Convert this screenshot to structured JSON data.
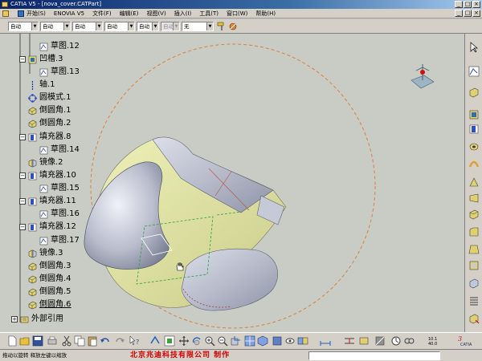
{
  "window": {
    "title": "CATIA V5 - [nova_cover.CATPart]",
    "controls": [
      "_",
      "□",
      "×"
    ]
  },
  "menubar": {
    "items": [
      "开始(S)",
      "ENOVIA V5",
      "文件(F)",
      "编辑(E)",
      "视图(V)",
      "插入(I)",
      "工具(T)",
      "窗口(W)",
      "帮助(H)"
    ]
  },
  "properties_toolbar": {
    "combos": [
      "自动",
      "自动",
      "自动",
      "自动",
      "自动",
      "自动",
      "",
      "无"
    ]
  },
  "tree": {
    "items": [
      {
        "label": "草图.12",
        "icon": "sketch-icon"
      },
      {
        "label": "凹槽.3",
        "icon": "groove-icon",
        "expander": "−"
      },
      {
        "label": "草图.13",
        "icon": "sketch-icon"
      },
      {
        "label": "轴.1",
        "icon": "axis-icon"
      },
      {
        "label": "圆模式.1",
        "icon": "circular-pattern-icon"
      },
      {
        "label": "倒圆角.1",
        "icon": "fillet-icon"
      },
      {
        "label": "倒圆角.2",
        "icon": "fillet-icon"
      },
      {
        "label": "填充器.8",
        "icon": "filler-icon",
        "expander": "−"
      },
      {
        "label": "草图.14",
        "icon": "sketch-icon"
      },
      {
        "label": "镜像.2",
        "icon": "mirror-icon"
      },
      {
        "label": "填充器.10",
        "icon": "filler-icon",
        "expander": "−"
      },
      {
        "label": "草图.15",
        "icon": "sketch-icon"
      },
      {
        "label": "填充器.11",
        "icon": "filler-icon",
        "expander": "−"
      },
      {
        "label": "草图.16",
        "icon": "sketch-icon"
      },
      {
        "label": "填充器.12",
        "icon": "filler-icon",
        "expander": "−"
      },
      {
        "label": "草图.17",
        "icon": "sketch-icon"
      },
      {
        "label": "镜像.3",
        "icon": "mirror-icon"
      },
      {
        "label": "倒圆角.3",
        "icon": "fillet-icon"
      },
      {
        "label": "倒圆角.4",
        "icon": "fillet-icon"
      },
      {
        "label": "倒圆角.5",
        "icon": "fillet-icon"
      },
      {
        "label": "倒圆角.6",
        "icon": "fillet-icon"
      },
      {
        "label": "外部引用",
        "icon": "external-references-icon",
        "expander": "+"
      }
    ]
  },
  "compass": {
    "icon": "compass-icon"
  },
  "status": {
    "left_text": "拖动以旋转   释放左键以缩放",
    "credit_text": "北京兆迪科技有限公司   制作",
    "command_value": ""
  },
  "colors": {
    "viewport_bg": "#c8ccc4",
    "part_body": "#c9cdd8",
    "part_yellow": "#e4e6a8",
    "credit_red": "#d40000",
    "circle_orange": "#d88040"
  }
}
